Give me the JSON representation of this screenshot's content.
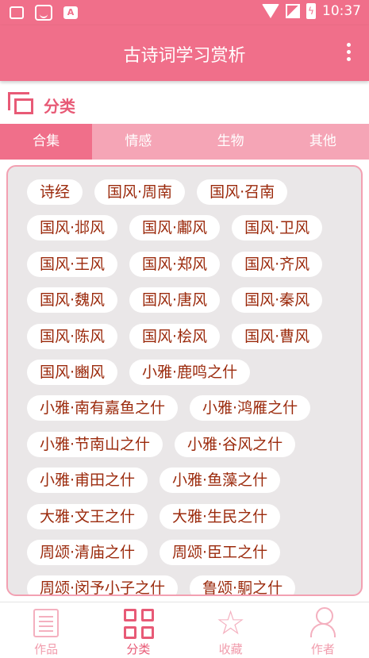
{
  "status_bar": {
    "time": "10:37",
    "icons": [
      "notification-icon",
      "message-face-icon",
      "app-a-icon",
      "wifi-icon",
      "signal-off-icon",
      "battery-charging-icon"
    ],
    "badge_letter": "A"
  },
  "app_bar": {
    "title": "古诗词学习赏析",
    "menu_icon": "more-vert-icon"
  },
  "section": {
    "title": "分类",
    "icon": "category-icon"
  },
  "tabs": [
    {
      "label": "合集",
      "active": true
    },
    {
      "label": "情感",
      "active": false
    },
    {
      "label": "生物",
      "active": false
    },
    {
      "label": "其他",
      "active": false
    }
  ],
  "chips": [
    "诗经",
    "国风·周南",
    "国风·召南",
    "国风·邶风",
    "国风·鄘风",
    "国风·卫风",
    "国风·王风",
    "国风·郑风",
    "国风·齐风",
    "国风·魏风",
    "国风·唐风",
    "国风·秦风",
    "国风·陈风",
    "国风·桧风",
    "国风·曹风",
    "国风·豳风",
    "小雅·鹿鸣之什",
    "小雅·南有嘉鱼之什",
    "小雅·鸿雁之什",
    "小雅·节南山之什",
    "小雅·谷风之什",
    "小雅·甫田之什",
    "小雅·鱼藻之什",
    "大雅·文王之什",
    "大雅·生民之什",
    "周颂·清庙之什",
    "周颂·臣工之什",
    "周颂·闵予小子之什",
    "鲁颂·駉之什"
  ],
  "colors": {
    "accent": "#f06f8a",
    "accent_dark": "#e85a76",
    "tab_inactive": "#f5a5b6",
    "chip_text": "#9b2a0c",
    "panel_bg": "#eae7e8"
  },
  "bottom_nav": [
    {
      "label": "作品",
      "icon": "document-icon",
      "active": false
    },
    {
      "label": "分类",
      "icon": "grid-icon",
      "active": true
    },
    {
      "label": "收藏",
      "icon": "star-icon",
      "active": false
    },
    {
      "label": "作者",
      "icon": "person-icon",
      "active": false
    }
  ]
}
